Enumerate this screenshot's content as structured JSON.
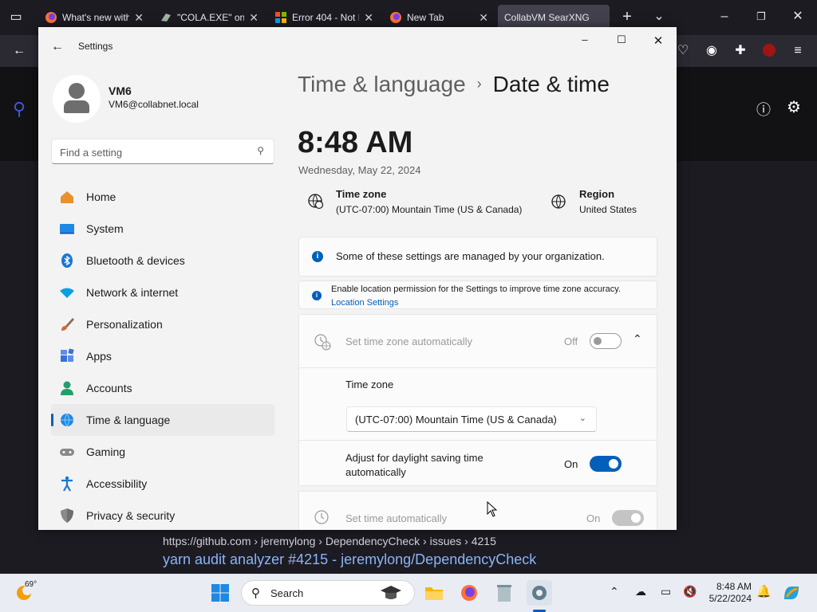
{
  "browser": {
    "tabs": [
      {
        "label": "What's new with",
        "icon": "firefox-icon"
      },
      {
        "label": "\"COLA.EXE\" on",
        "icon": "cola-icon"
      },
      {
        "label": "Error 404 - Not F",
        "icon": "microsoft-icon"
      },
      {
        "label": "New Tab",
        "icon": "firefox-icon"
      },
      {
        "label": "CollabVM SearXNG",
        "icon": "searxng-icon"
      }
    ],
    "new_tab_label": "+",
    "result": {
      "url": "https://github.com  › jeremylong › DependencyCheck › issues › 4215",
      "title": "yarn audit analyzer #4215 - jeremylong/DependencyCheck"
    }
  },
  "settings": {
    "window_title": "Settings",
    "user": {
      "name": "VM6",
      "email": "VM6@collabnet.local"
    },
    "search_placeholder": "Find a setting",
    "nav": [
      {
        "label": "Home",
        "icon": "home-icon",
        "color": "#e8912d"
      },
      {
        "label": "System",
        "icon": "monitor-icon",
        "color": "#1e88e5"
      },
      {
        "label": "Bluetooth & devices",
        "icon": "bluetooth-icon",
        "color": "#1976d2"
      },
      {
        "label": "Network & internet",
        "icon": "wifi-icon",
        "color": "#0aa0e0"
      },
      {
        "label": "Personalization",
        "icon": "brush-icon",
        "color": "#d46a2c"
      },
      {
        "label": "Apps",
        "icon": "apps-icon",
        "color": "#3a6fd8"
      },
      {
        "label": "Accounts",
        "icon": "person-icon",
        "color": "#22a06b"
      },
      {
        "label": "Time & language",
        "icon": "globe-clock-icon",
        "color": "#1e88e5",
        "selected": true
      },
      {
        "label": "Gaming",
        "icon": "gamepad-icon",
        "color": "#888888"
      },
      {
        "label": "Accessibility",
        "icon": "accessibility-icon",
        "color": "#1976d2"
      },
      {
        "label": "Privacy & security",
        "icon": "shield-icon",
        "color": "#8a8a8a"
      }
    ],
    "breadcrumb": {
      "parent": "Time & language",
      "separator": "›",
      "current": "Date & time"
    },
    "clock": {
      "time": "8:48 AM",
      "date": "Wednesday, May 22, 2024"
    },
    "timezone_info": {
      "label": "Time zone",
      "value": "(UTC-07:00) Mountain Time (US & Canada)"
    },
    "region_info": {
      "label": "Region",
      "value": "United States"
    },
    "managed_notice": "Some of these settings are managed by your organization.",
    "location_notice": {
      "text": "Enable location permission for the Settings to improve time zone accuracy.",
      "link": "Location Settings"
    },
    "auto_timezone": {
      "label": "Set time zone automatically",
      "state": "Off"
    },
    "timezone_select": {
      "label": "Time zone",
      "value": "(UTC-07:00) Mountain Time (US & Canada)"
    },
    "dst": {
      "label_line1": "Adjust for daylight saving time",
      "label_line2": "automatically",
      "state": "On"
    },
    "auto_time": {
      "label": "Set time automatically",
      "state": "On"
    }
  },
  "taskbar": {
    "weather_temp": "69°",
    "search_label": "Search",
    "clock_time": "8:48 AM",
    "clock_date": "5/22/2024"
  }
}
